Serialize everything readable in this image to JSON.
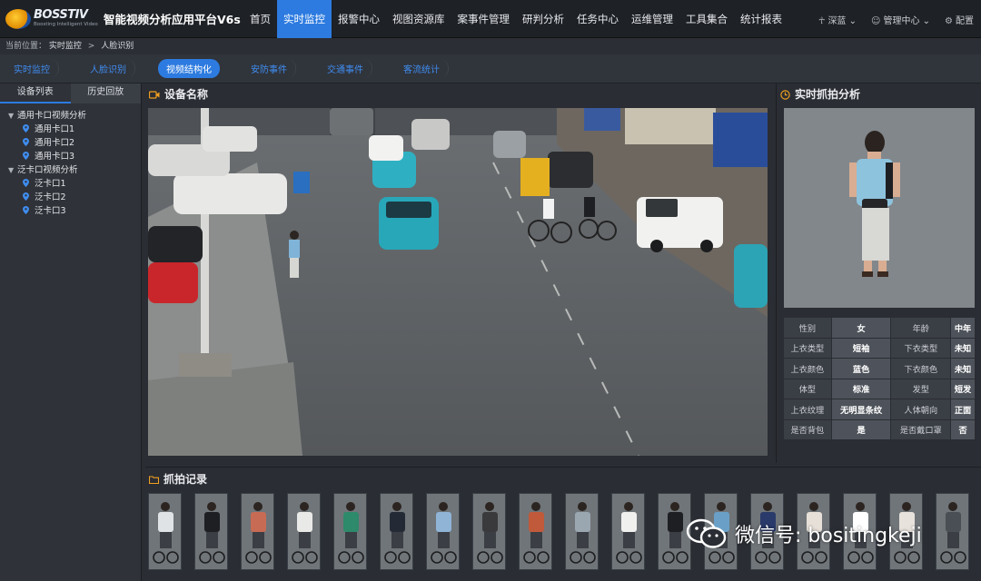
{
  "header": {
    "brand": "BOSSTIV",
    "tagline": "Boosting Intelligent Video",
    "app_title": "智能视频分析应用平台V6s",
    "nav": [
      {
        "label": "首页"
      },
      {
        "label": "实时监控",
        "active": true
      },
      {
        "label": "报警中心"
      },
      {
        "label": "视图资源库"
      },
      {
        "label": "案事件管理"
      },
      {
        "label": "研判分析"
      },
      {
        "label": "任务中心"
      },
      {
        "label": "运维管理"
      },
      {
        "label": "工具集合"
      },
      {
        "label": "统计报表"
      }
    ],
    "theme_label": "深蓝",
    "user_label": "管理中心",
    "settings_label": "配置"
  },
  "breadcrumb": {
    "prefix": "当前位置：",
    "level1": "实时监控",
    "separator": ">",
    "level2": "人脸识别"
  },
  "subnav": [
    {
      "label": "实时监控"
    },
    {
      "label": "人脸识别"
    },
    {
      "label": "视频结构化",
      "active": true
    },
    {
      "label": "安防事件"
    },
    {
      "label": "交通事件"
    },
    {
      "label": "客流统计"
    }
  ],
  "sidebar": {
    "tabs": [
      {
        "label": "设备列表",
        "active": true
      },
      {
        "label": "历史回放"
      }
    ],
    "groups": [
      {
        "label": "通用卡口视频分析",
        "items": [
          "通用卡口1",
          "通用卡口2",
          "通用卡口3"
        ]
      },
      {
        "label": "泛卡口视频分析",
        "items": [
          "泛卡口1",
          "泛卡口2",
          "泛卡口3"
        ]
      }
    ]
  },
  "video_panel": {
    "title": "设备名称"
  },
  "capture_panel": {
    "title": "实时抓拍分析",
    "attributes": [
      [
        "性别",
        "女",
        "年龄",
        "中年"
      ],
      [
        "上衣类型",
        "短袖",
        "下衣类型",
        "未知"
      ],
      [
        "上衣颜色",
        "蓝色",
        "下衣颜色",
        "未知"
      ],
      [
        "体型",
        "标准",
        "发型",
        "短发"
      ],
      [
        "上衣纹理",
        "无明显条纹",
        "人体朝向",
        "正面"
      ],
      [
        "是否背包",
        "是",
        "是否戴口罩",
        "否"
      ]
    ]
  },
  "records": {
    "title": "抓拍记录",
    "count": 18
  },
  "watermark": {
    "text": "微信号: bositingkeji"
  },
  "colors": {
    "accent": "#2d7be0",
    "header_bg": "#1e2126",
    "panel_bg": "#2a2d33",
    "pin": "#3f8df0"
  },
  "icons": {
    "video": "video-camera-icon",
    "capture": "clock-icon",
    "records": "folder-icon"
  }
}
